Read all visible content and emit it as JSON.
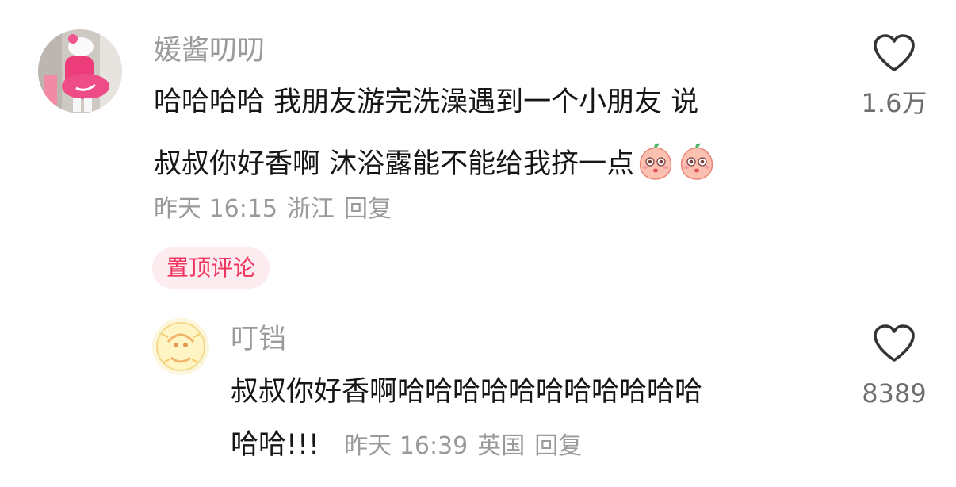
{
  "comments": [
    {
      "username": "媛酱叨叨",
      "lines": [
        "哈哈哈哈 我朋友游完洗澡遇到一个小朋友 说",
        "叔叔你好香啊 沐浴露能不能给我挤一点"
      ],
      "time": "昨天 16:15",
      "location": "浙江",
      "reply_label": "回复",
      "likes": "1.6万",
      "pin_label": "置顶评论",
      "emoji_icon": "peach-emoji-icon"
    },
    {
      "username": "叮铛",
      "lines": [
        "叔叔你好香啊哈哈哈哈哈哈哈哈哈哈哈",
        "哈哈!!!"
      ],
      "time": "昨天 16:39",
      "location": "英国",
      "reply_label": "回复",
      "likes": "8389"
    }
  ],
  "colors": {
    "accent": "#f0335f",
    "pin_background": "#fdecef",
    "muted_text": "#9a9a9a"
  }
}
